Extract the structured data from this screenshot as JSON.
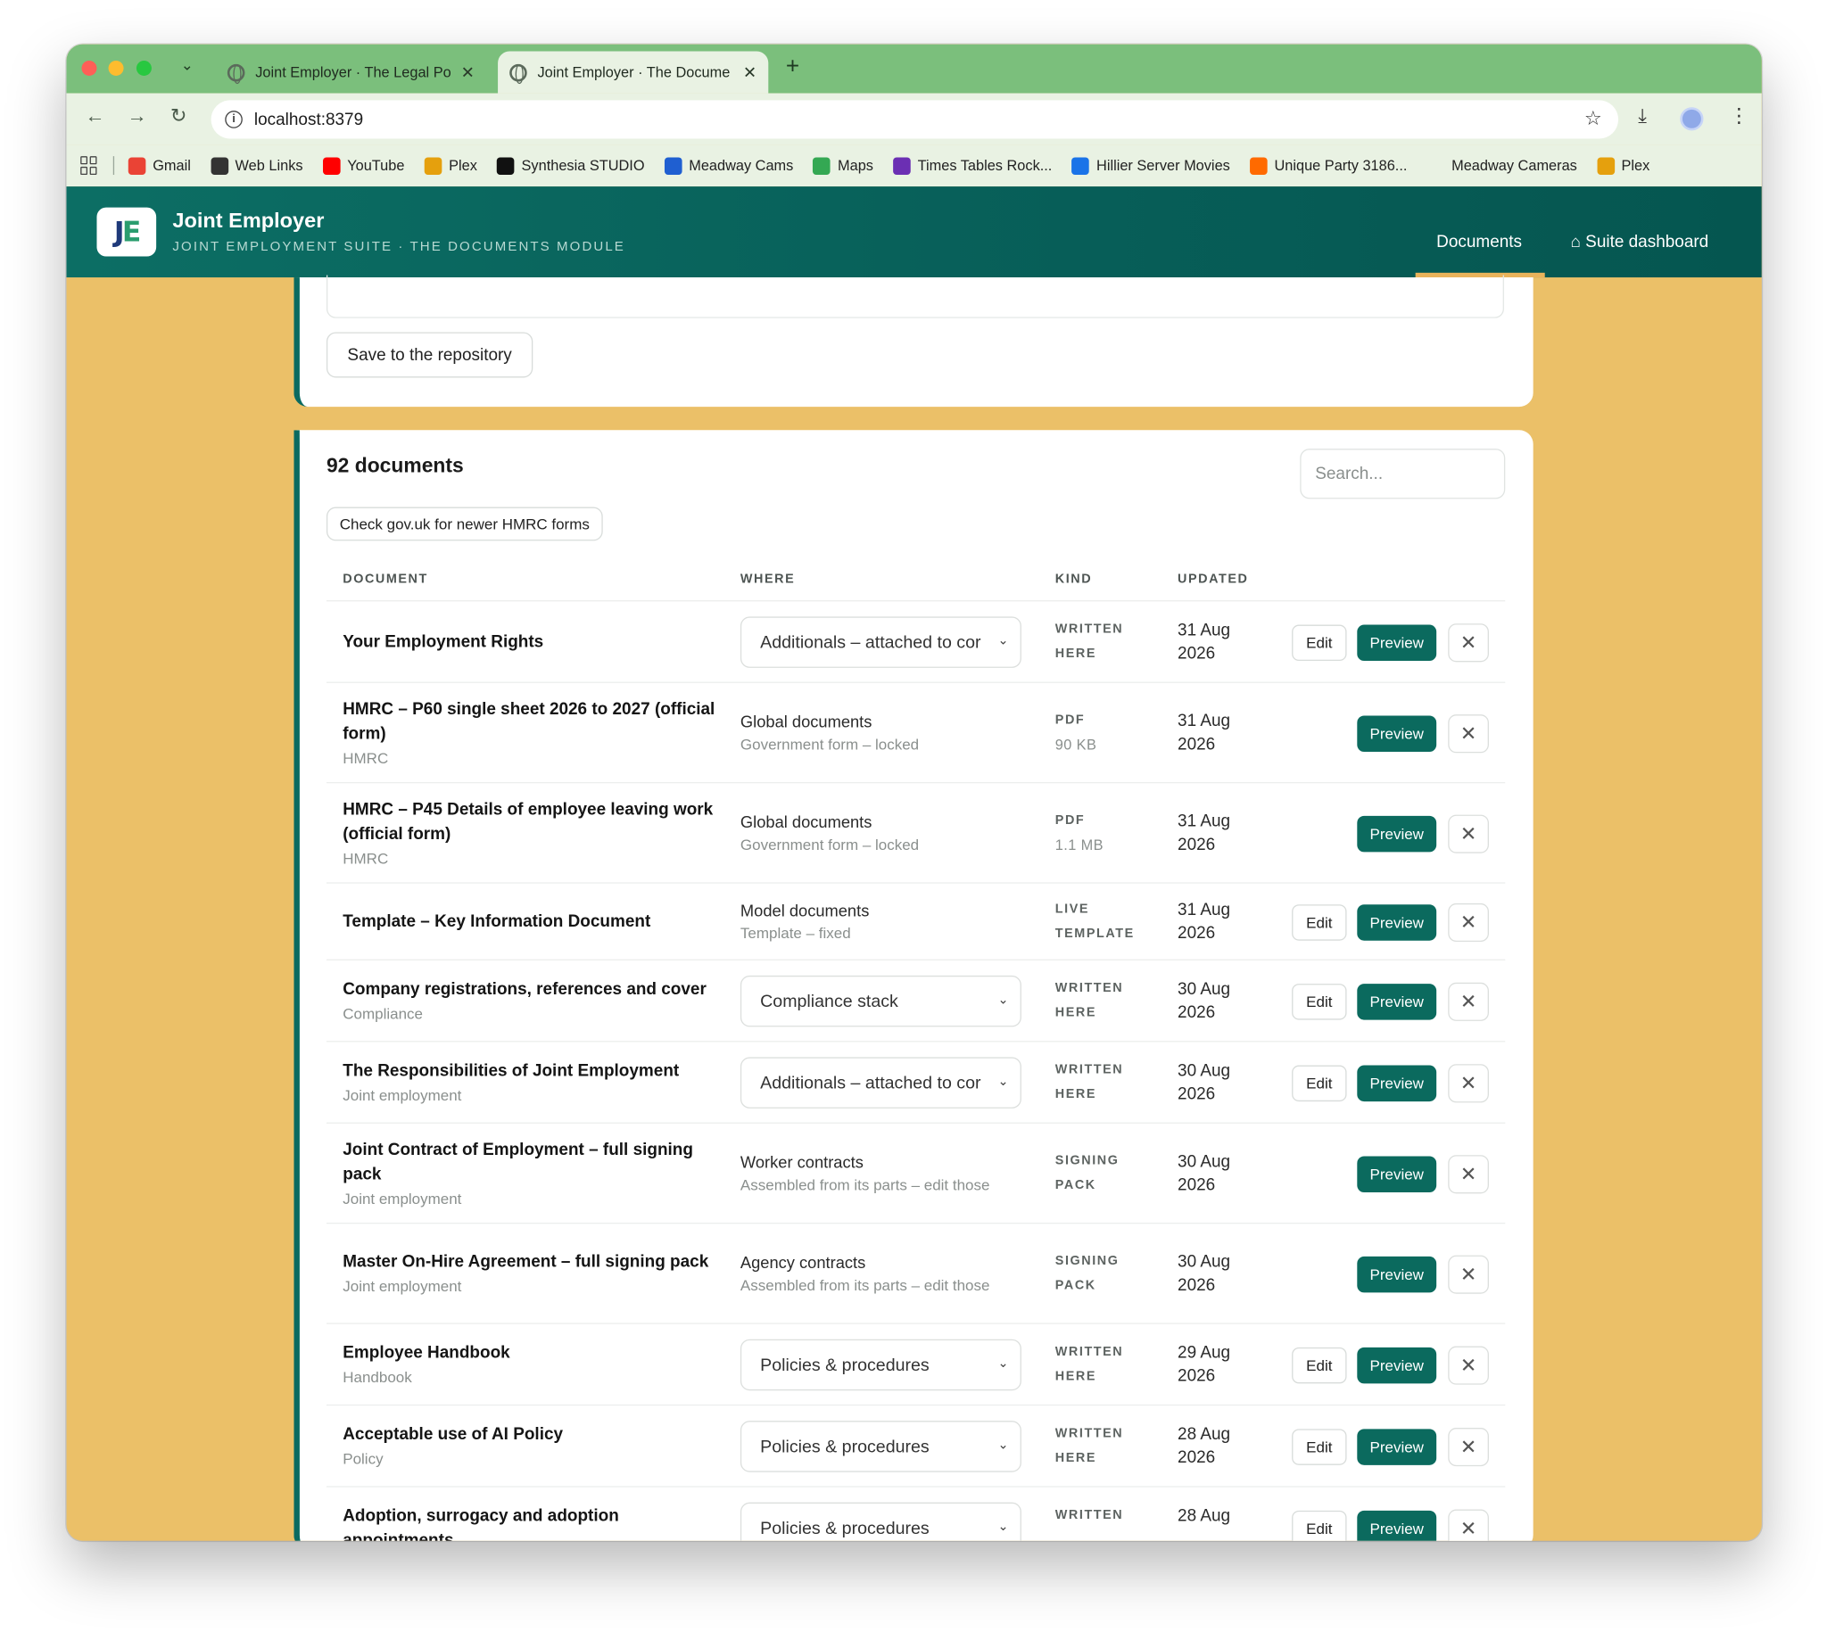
{
  "browser": {
    "tabs": [
      {
        "title": "Joint Employer · The Legal Po"
      },
      {
        "title": "Joint Employer · The Docume"
      }
    ],
    "url": "localhost:8379",
    "bookmarks": [
      {
        "label": "Gmail",
        "icon": "gmail-icon",
        "color": "#ea4335"
      },
      {
        "label": "Web Links",
        "icon": "globe-icon",
        "color": "#333333"
      },
      {
        "label": "YouTube",
        "icon": "youtube-icon",
        "color": "#ff0000"
      },
      {
        "label": "Plex",
        "icon": "plex-icon",
        "color": "#e5a00d"
      },
      {
        "label": "Synthesia STUDIO",
        "icon": "synthesia-icon",
        "color": "#111111"
      },
      {
        "label": "Meadway Cams",
        "icon": "u-icon",
        "color": "#1f5fd1"
      },
      {
        "label": "Maps",
        "icon": "maps-pin-icon",
        "color": "#34a853"
      },
      {
        "label": "Times Tables Rock...",
        "icon": "ttrs-icon",
        "color": "#6b2fb3"
      },
      {
        "label": "Hillier Server Movies",
        "icon": "dsm-icon",
        "color": "#1a73e8"
      },
      {
        "label": "Unique Party 3186...",
        "icon": "party-icon",
        "color": "#ff6a00"
      },
      {
        "label": "Meadway Cameras",
        "icon": "blank-icon",
        "color": "#e9f2e3"
      },
      {
        "label": "Plex",
        "icon": "plex-icon",
        "color": "#e5a00d"
      }
    ]
  },
  "app": {
    "logo_j": "J",
    "logo_e": "E",
    "title": "Joint Employer",
    "subtitle": "JOINT EMPLOYMENT SUITE · THE DOCUMENTS MODULE",
    "nav": {
      "documents": "Documents",
      "suite": "⌂ Suite dashboard"
    },
    "accent": "#0b6a5e"
  },
  "form": {
    "save_label": "Save to the repository"
  },
  "documents": {
    "count_label": "92 documents",
    "search_placeholder": "Search...",
    "check_label": "Check gov.uk for newer HMRC forms",
    "columns": {
      "document": "DOCUMENT",
      "where": "WHERE",
      "kind": "KIND",
      "updated": "UPDATED"
    },
    "actions": {
      "edit": "Edit",
      "preview": "Preview",
      "remove": "✕"
    },
    "rows": [
      {
        "name": "Your Employment Rights",
        "sub": "",
        "where_select": "Additionals – attached to cor",
        "where": "",
        "where_sub": "",
        "kind": "WRITTEN",
        "kind2": "HERE",
        "kind_sub": "",
        "date1": "31 Aug",
        "date2": "2026",
        "editable": true
      },
      {
        "name": "HMRC – P60 single sheet 2026 to 2027 (official form)",
        "sub": "HMRC",
        "where_select": "",
        "where": "Global documents",
        "where_sub": "Government form – locked",
        "kind": "PDF",
        "kind2": "",
        "kind_sub": "90 KB",
        "date1": "31 Aug",
        "date2": "2026",
        "editable": false
      },
      {
        "name": "HMRC – P45 Details of employee leaving work (official form)",
        "sub": "HMRC",
        "where_select": "",
        "where": "Global documents",
        "where_sub": "Government form – locked",
        "kind": "PDF",
        "kind2": "",
        "kind_sub": "1.1 MB",
        "date1": "31 Aug",
        "date2": "2026",
        "editable": false
      },
      {
        "name": "Template – Key Information Document",
        "sub": "",
        "where_select": "",
        "where": "Model documents",
        "where_sub": "Template – fixed",
        "kind": "LIVE",
        "kind2": "TEMPLATE",
        "kind_sub": "",
        "date1": "31 Aug",
        "date2": "2026",
        "editable": true
      },
      {
        "name": "Company registrations, references and cover",
        "sub": "Compliance",
        "where_select": "Compliance stack",
        "where": "",
        "where_sub": "",
        "kind": "WRITTEN",
        "kind2": "HERE",
        "kind_sub": "",
        "date1": "30 Aug",
        "date2": "2026",
        "editable": true
      },
      {
        "name": "The Responsibilities of Joint Employment",
        "sub": "Joint employment",
        "where_select": "Additionals – attached to cor",
        "where": "",
        "where_sub": "",
        "kind": "WRITTEN",
        "kind2": "HERE",
        "kind_sub": "",
        "date1": "30 Aug",
        "date2": "2026",
        "editable": true
      },
      {
        "name": "Joint Contract of Employment – full signing pack",
        "sub": "Joint employment",
        "where_select": "",
        "where": "Worker contracts",
        "where_sub": "Assembled from its parts – edit those",
        "kind": "SIGNING",
        "kind2": "PACK",
        "kind_sub": "",
        "date1": "30 Aug",
        "date2": "2026",
        "editable": false
      },
      {
        "name": "Master On-Hire Agreement – full signing pack",
        "sub": "Joint employment",
        "where_select": "",
        "where": "Agency contracts",
        "where_sub": "Assembled from its parts – edit those",
        "kind": "SIGNING",
        "kind2": "PACK",
        "kind_sub": "",
        "date1": "30 Aug",
        "date2": "2026",
        "editable": false
      },
      {
        "name": "Employee Handbook",
        "sub": "Handbook",
        "where_select": "Policies & procedures",
        "where": "",
        "where_sub": "",
        "kind": "WRITTEN",
        "kind2": "HERE",
        "kind_sub": "",
        "date1": "29 Aug",
        "date2": "2026",
        "editable": true
      },
      {
        "name": "Acceptable use of AI Policy",
        "sub": "Policy",
        "where_select": "Policies & procedures",
        "where": "",
        "where_sub": "",
        "kind": "WRITTEN",
        "kind2": "HERE",
        "kind_sub": "",
        "date1": "28 Aug",
        "date2": "2026",
        "editable": true
      },
      {
        "name": "Adoption, surrogacy and adoption appointments",
        "sub": "",
        "where_select": "Policies & procedures",
        "where": "",
        "where_sub": "",
        "kind": "WRITTEN",
        "kind2": "",
        "kind_sub": "",
        "date1": "28 Aug",
        "date2": "",
        "editable": true
      }
    ]
  }
}
